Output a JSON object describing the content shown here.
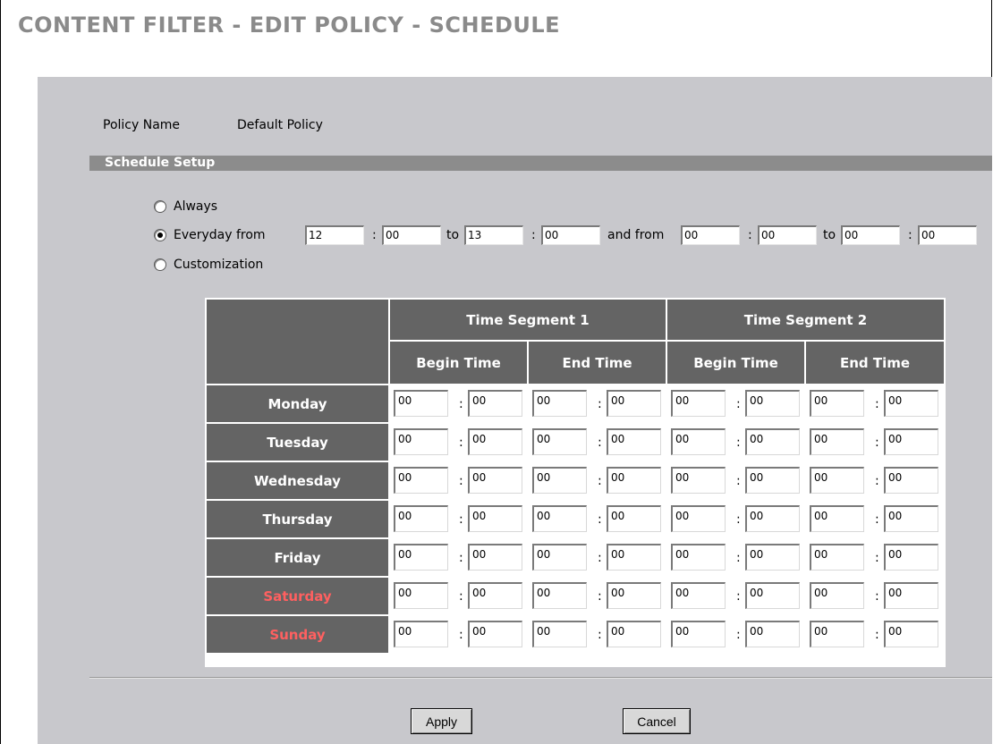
{
  "page_title": "CONTENT FILTER - EDIT POLICY - SCHEDULE",
  "policy": {
    "label": "Policy Name",
    "value": "Default Policy"
  },
  "schedule_setup": {
    "title": "Schedule Setup",
    "options": {
      "always": "Always",
      "everyday": "Everyday from",
      "customization": "Customization"
    },
    "selected": "everyday",
    "everyday": {
      "from1_hour": "12",
      "from1_min": "00",
      "to_label": "to",
      "to1_hour": "13",
      "to1_min": "00",
      "and_from_label": "and from",
      "from2_hour": "00",
      "from2_min": "00",
      "to2_hour": "00",
      "to2_min": "00",
      "colon": ":"
    }
  },
  "table": {
    "segment_headers": [
      "Time Segment 1",
      "Time Segment 2"
    ],
    "sub_headers": [
      "Begin Time",
      "End Time",
      "Begin Time",
      "End Time"
    ],
    "days": [
      {
        "name": "Monday",
        "weekend": false,
        "values": [
          "00",
          "00",
          "00",
          "00",
          "00",
          "00",
          "00",
          "00"
        ]
      },
      {
        "name": "Tuesday",
        "weekend": false,
        "values": [
          "00",
          "00",
          "00",
          "00",
          "00",
          "00",
          "00",
          "00"
        ]
      },
      {
        "name": "Wednesday",
        "weekend": false,
        "values": [
          "00",
          "00",
          "00",
          "00",
          "00",
          "00",
          "00",
          "00"
        ]
      },
      {
        "name": "Thursday",
        "weekend": false,
        "values": [
          "00",
          "00",
          "00",
          "00",
          "00",
          "00",
          "00",
          "00"
        ]
      },
      {
        "name": "Friday",
        "weekend": false,
        "values": [
          "00",
          "00",
          "00",
          "00",
          "00",
          "00",
          "00",
          "00"
        ]
      },
      {
        "name": "Saturday",
        "weekend": true,
        "values": [
          "00",
          "00",
          "00",
          "00",
          "00",
          "00",
          "00",
          "00"
        ]
      },
      {
        "name": "Sunday",
        "weekend": true,
        "values": [
          "00",
          "00",
          "00",
          "00",
          "00",
          "00",
          "00",
          "00"
        ]
      }
    ],
    "weekend_color": "#ff6060",
    "header_color": "#646464"
  },
  "buttons": {
    "apply": "Apply",
    "cancel": "Cancel"
  }
}
